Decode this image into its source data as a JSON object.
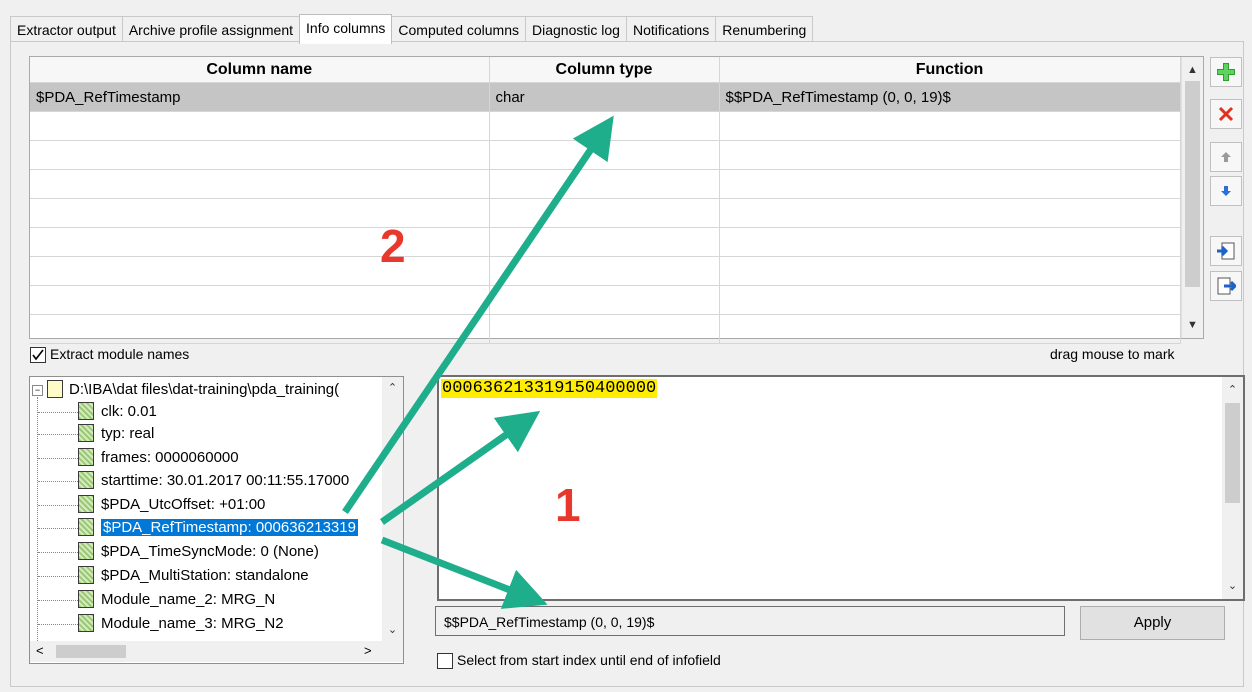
{
  "tabs": [
    "Extractor output",
    "Archive profile assignment",
    "Info columns",
    "Computed columns",
    "Diagnostic log",
    "Notifications",
    "Renumbering"
  ],
  "active_tab": "Info columns",
  "grid": {
    "headers": [
      "Column name",
      "Column type",
      "Function"
    ],
    "rows": [
      {
        "name": "$PDA_RefTimestamp",
        "type": "char",
        "function": "$$PDA_RefTimestamp (0, 0, 19)$"
      }
    ]
  },
  "side_buttons": [
    "add-icon",
    "delete-icon",
    "move-up-icon",
    "move-down-icon",
    "import-icon",
    "export-icon"
  ],
  "extract_module_names": {
    "label": "Extract module names",
    "checked": true
  },
  "drag_hint": "drag mouse to mark",
  "tree": {
    "root": "D:\\IBA\\dat files\\dat-training\\pda_training(",
    "items": [
      "clk: 0.01",
      "typ: real",
      "frames: 0000060000",
      "starttime: 30.01.2017 00:11:55.17000",
      "$PDA_UtcOffset: +01:00",
      "$PDA_RefTimestamp: 000636213319",
      "$PDA_TimeSyncMode: 0 (None)",
      "$PDA_MultiStation: standalone",
      "Module_name_2: MRG_N",
      "Module_name_3: MRG_N2"
    ],
    "selected_index": 5
  },
  "textbox": {
    "highlighted": "000636213319150400000"
  },
  "function_field": "$$PDA_RefTimestamp (0, 0, 19)$",
  "apply_label": "Apply",
  "select_to_end": {
    "label": "Select from start index until end of infofield",
    "checked": false
  },
  "callouts": [
    "1",
    "2"
  ],
  "annotation_color": "#1fae8c"
}
